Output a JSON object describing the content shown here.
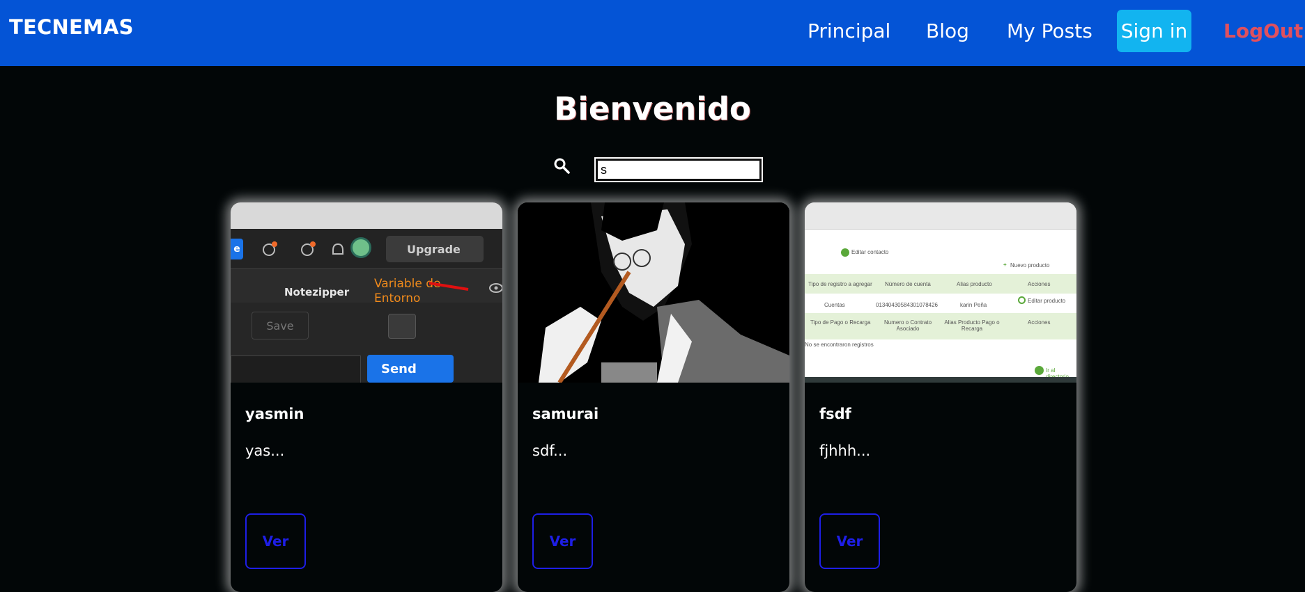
{
  "navbar": {
    "brand": "TECNEMAS",
    "links": [
      "Principal",
      "Blog",
      "My Posts"
    ],
    "signin_label": "Sign in",
    "logout_label": "LogOut",
    "bg_color": "#0454d6",
    "signin_color": "#12b4f0",
    "logout_color": "#e0505e"
  },
  "main": {
    "title": "Bienvenido",
    "search": {
      "icon": "search-icon",
      "value": "s"
    }
  },
  "cards": [
    {
      "title": "yasmin",
      "excerpt": "yas...",
      "button_label": "Ver",
      "image": {
        "upgrade_label": "Upgrade",
        "collection_label": "Notezipper",
        "annotation": "Variable de Entorno",
        "save_label": "Save",
        "send_label": "Send",
        "side_tab": "e"
      }
    },
    {
      "title": "samurai",
      "excerpt": "sdf...",
      "button_label": "Ver"
    },
    {
      "title": "fsdf",
      "excerpt": "fjhhh...",
      "button_label": "Ver",
      "image": {
        "edit_contact": "Editar contacto",
        "new_product": "Nuevo producto",
        "table1_headers": [
          "Tipo de registro a agregar",
          "Número de cuenta",
          "Alias producto",
          "Acciones"
        ],
        "table1_row": [
          "Cuentas",
          "01340430584301078426",
          "karin Peña",
          "Editar producto"
        ],
        "table2_headers": [
          "Tipo de Pago o Recarga",
          "Numero o Contrato Asociado",
          "Alias Producto Pago o Recarga",
          "Acciones"
        ],
        "empty_msg": "No se encontraron registros",
        "go_link": "Ir al directorio"
      }
    }
  ],
  "colors": {
    "page_bg": "#020607",
    "button_border": "#1e1ee6"
  }
}
